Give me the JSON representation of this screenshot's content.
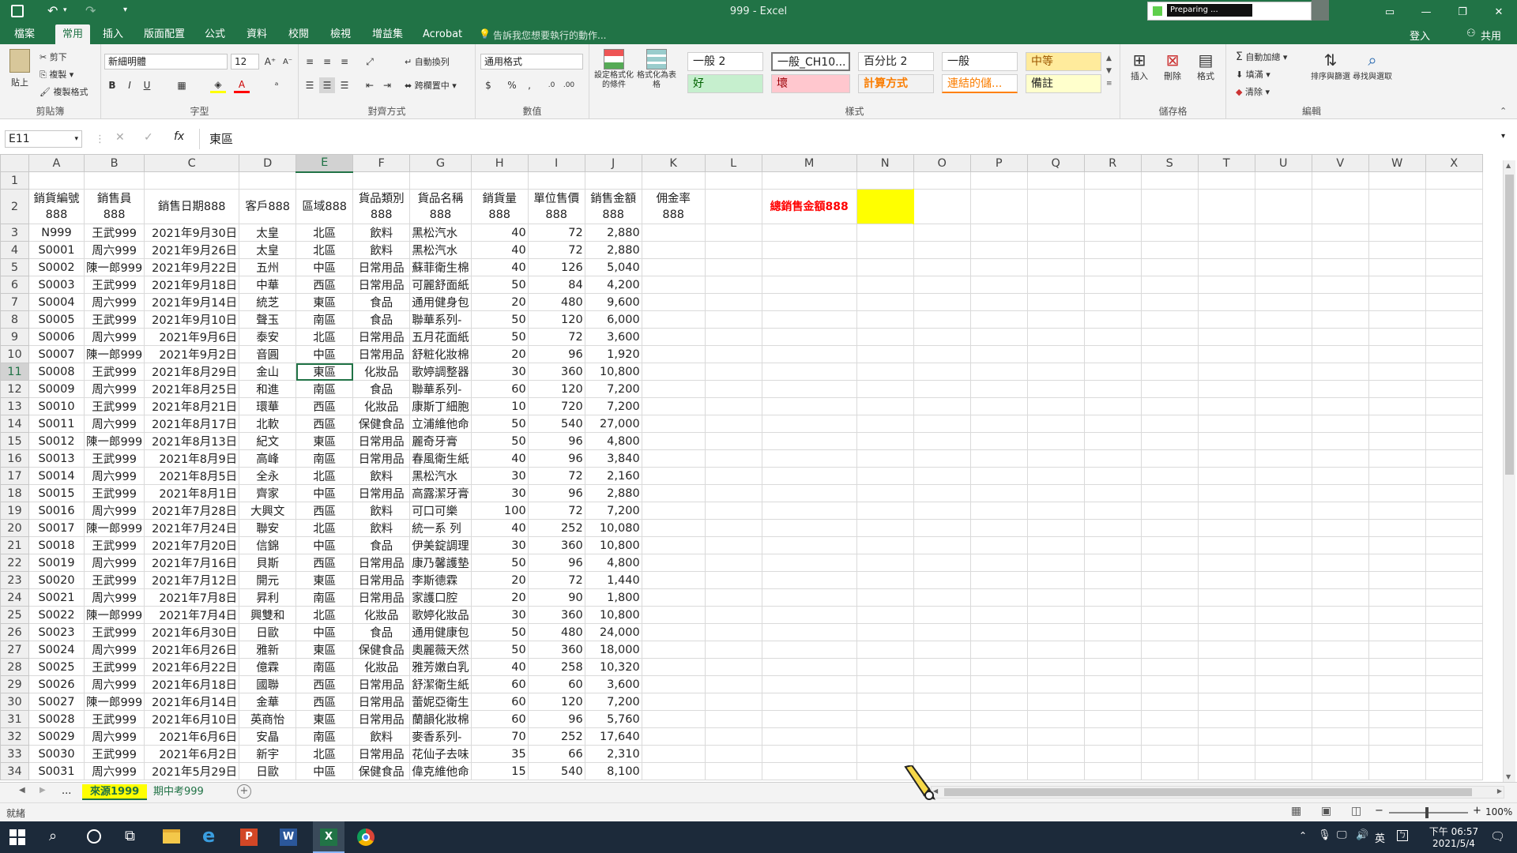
{
  "window": {
    "title": "999 - Excel",
    "preparing": "Preparing ..."
  },
  "qat": {
    "save_icon": "save-icon",
    "undo_icon": "undo-icon",
    "redo_icon": "redo-icon"
  },
  "tabs": [
    "檔案",
    "常用",
    "插入",
    "版面配置",
    "公式",
    "資料",
    "校閱",
    "檢視",
    "增益集",
    "Acrobat"
  ],
  "tellme": "告訴我您想要執行的動作...",
  "account": {
    "signin": "登入",
    "share": "共用"
  },
  "ribbon": {
    "clipboard": {
      "paste": "貼上",
      "cut": "剪下",
      "copy": "複製",
      "format_painter": "複製格式",
      "label": "剪貼簿"
    },
    "font": {
      "name": "新細明體",
      "size": "12",
      "label": "字型"
    },
    "align": {
      "wrap": "自動換列",
      "merge": "跨欄置中",
      "label": "對齊方式"
    },
    "number": {
      "format": "通用格式",
      "label": "數值"
    },
    "styles_btns": {
      "cond": "設定格式化的條件",
      "table": "格式化為表格"
    },
    "styles": {
      "s1": "一般 2",
      "s2": "一般_CH10...",
      "s3": "百分比 2",
      "s4": "一般",
      "s5": "中等",
      "s6": "好",
      "s7": "壞",
      "s8": "計算方式",
      "s9": "連結的儲...",
      "s10": "備註",
      "label": "樣式"
    },
    "cells": {
      "insert": "插入",
      "delete": "刪除",
      "format": "格式",
      "label": "儲存格"
    },
    "editing": {
      "autosum": "自動加總",
      "fill": "填滿",
      "clear": "清除",
      "sort": "排序與篩選",
      "find": "尋找與選取",
      "label": "編輯"
    }
  },
  "formula": {
    "namebox": "E11",
    "fx": "fx",
    "value": "東區"
  },
  "columns": [
    "A",
    "B",
    "C",
    "D",
    "E",
    "F",
    "G",
    "H",
    "I",
    "J",
    "K",
    "L",
    "M",
    "N",
    "O",
    "P",
    "Q",
    "R",
    "S",
    "T",
    "U",
    "V",
    "W",
    "X"
  ],
  "header_row": [
    "銷貨編號 888",
    "銷售員 888",
    "銷售日期888",
    "客戶888",
    "區域888",
    "貨品類別 888",
    "貨品名稱 888",
    "銷貨量 888",
    "單位售價 888",
    "銷售金額 888",
    "佣金率 888"
  ],
  "total_label": "總銷售金額888",
  "rows": [
    [
      "N999",
      "王武999",
      "2021年9月30日",
      "太皇",
      "北區",
      "飲料",
      "黑松汽水",
      "40",
      "72",
      "2,880"
    ],
    [
      "S0001",
      "周六999",
      "2021年9月26日",
      "太皇",
      "北區",
      "飲料",
      "黑松汽水",
      "40",
      "72",
      "2,880"
    ],
    [
      "S0002",
      "陳一郎999",
      "2021年9月22日",
      "五州",
      "中區",
      "日常用品",
      "蘇菲衛生棉",
      "40",
      "126",
      "5,040"
    ],
    [
      "S0003",
      "王武999",
      "2021年9月18日",
      "中華",
      "西區",
      "日常用品",
      "可麗舒面紙",
      "50",
      "84",
      "4,200"
    ],
    [
      "S0004",
      "周六999",
      "2021年9月14日",
      "統芝",
      "東區",
      "食品",
      "通用健身包",
      "20",
      "480",
      "9,600"
    ],
    [
      "S0005",
      "王武999",
      "2021年9月10日",
      "聲玉",
      "南區",
      "食品",
      "聯華系列-",
      "50",
      "120",
      "6,000"
    ],
    [
      "S0006",
      "周六999",
      "2021年9月6日",
      "泰安",
      "北區",
      "日常用品",
      "五月花面紙",
      "50",
      "72",
      "3,600"
    ],
    [
      "S0007",
      "陳一郎999",
      "2021年9月2日",
      "音圓",
      "中區",
      "日常用品",
      "舒粧化妝棉",
      "20",
      "96",
      "1,920"
    ],
    [
      "S0008",
      "王武999",
      "2021年8月29日",
      "金山",
      "東區",
      "化妝品",
      "歌婷調整器",
      "30",
      "360",
      "10,800"
    ],
    [
      "S0009",
      "周六999",
      "2021年8月25日",
      "和進",
      "南區",
      "食品",
      "聯華系列-",
      "60",
      "120",
      "7,200"
    ],
    [
      "S0010",
      "王武999",
      "2021年8月21日",
      "環華",
      "西區",
      "化妝品",
      "康斯丁細胞",
      "10",
      "720",
      "7,200"
    ],
    [
      "S0011",
      "周六999",
      "2021年8月17日",
      "北軟",
      "西區",
      "保健食品",
      "立浦維他命",
      "50",
      "540",
      "27,000"
    ],
    [
      "S0012",
      "陳一郎999",
      "2021年8月13日",
      "紀文",
      "東區",
      "日常用品",
      "麗奇牙膏",
      "50",
      "96",
      "4,800"
    ],
    [
      "S0013",
      "王武999",
      "2021年8月9日",
      "高峰",
      "南區",
      "日常用品",
      "春風衛生紙",
      "40",
      "96",
      "3,840"
    ],
    [
      "S0014",
      "周六999",
      "2021年8月5日",
      "全永",
      "北區",
      "飲料",
      "黑松汽水",
      "30",
      "72",
      "2,160"
    ],
    [
      "S0015",
      "王武999",
      "2021年8月1日",
      "齊家",
      "中區",
      "日常用品",
      "高露潔牙膏",
      "30",
      "96",
      "2,880"
    ],
    [
      "S0016",
      "周六999",
      "2021年7月28日",
      "大興文",
      "西區",
      "飲料",
      "可口可樂",
      "100",
      "72",
      "7,200"
    ],
    [
      "S0017",
      "陳一郎999",
      "2021年7月24日",
      "聯安",
      "北區",
      "飲料",
      "統一系 列",
      "40",
      "252",
      "10,080"
    ],
    [
      "S0018",
      "王武999",
      "2021年7月20日",
      "信錦",
      "中區",
      "食品",
      "伊美錠調理",
      "30",
      "360",
      "10,800"
    ],
    [
      "S0019",
      "周六999",
      "2021年7月16日",
      "貝斯",
      "西區",
      "日常用品",
      "康乃馨護墊",
      "50",
      "96",
      "4,800"
    ],
    [
      "S0020",
      "王武999",
      "2021年7月12日",
      "開元",
      "東區",
      "日常用品",
      "李斯德霖",
      "20",
      "72",
      "1,440"
    ],
    [
      "S0021",
      "周六999",
      "2021年7月8日",
      "昇利",
      "南區",
      "日常用品",
      "家護口腔",
      "20",
      "90",
      "1,800"
    ],
    [
      "S0022",
      "陳一郎999",
      "2021年7月4日",
      "興雙和",
      "北區",
      "化妝品",
      "歌婷化妝品",
      "30",
      "360",
      "10,800"
    ],
    [
      "S0023",
      "王武999",
      "2021年6月30日",
      "日歐",
      "中區",
      "食品",
      "通用健康包",
      "50",
      "480",
      "24,000"
    ],
    [
      "S0024",
      "周六999",
      "2021年6月26日",
      "雅新",
      "東區",
      "保健食品",
      "奧麗薇天然",
      "50",
      "360",
      "18,000"
    ],
    [
      "S0025",
      "王武999",
      "2021年6月22日",
      "億霖",
      "南區",
      "化妝品",
      "雅芳嫩白乳",
      "40",
      "258",
      "10,320"
    ],
    [
      "S0026",
      "周六999",
      "2021年6月18日",
      "國聯",
      "西區",
      "日常用品",
      "舒潔衛生紙",
      "60",
      "60",
      "3,600"
    ],
    [
      "S0027",
      "陳一郎999",
      "2021年6月14日",
      "金華",
      "西區",
      "日常用品",
      "蕾妮亞衛生",
      "60",
      "120",
      "7,200"
    ],
    [
      "S0028",
      "王武999",
      "2021年6月10日",
      "英商怡",
      "東區",
      "日常用品",
      "蘭韻化妝棉",
      "60",
      "96",
      "5,760"
    ],
    [
      "S0029",
      "周六999",
      "2021年6月6日",
      "安晶",
      "南區",
      "飲料",
      "麥香系列-",
      "70",
      "252",
      "17,640"
    ],
    [
      "S0030",
      "王武999",
      "2021年6月2日",
      "新宇",
      "北區",
      "日常用品",
      "花仙子去味",
      "35",
      "66",
      "2,310"
    ],
    [
      "S0031",
      "周六999",
      "2021年5月29日",
      "日歐",
      "中區",
      "保健食品",
      "偉克維他命",
      "15",
      "540",
      "8,100"
    ]
  ],
  "sheets": {
    "more": "...",
    "tab1": "來源1999",
    "tab2": "期中考999"
  },
  "status": {
    "ready": "就緒",
    "zoom": "100%"
  },
  "taskbar": {
    "time": "下午 06:57",
    "date": "2021/5/4",
    "ime": "英"
  },
  "colors": {
    "excel_green": "#217346",
    "highlight_yellow": "#ffff00",
    "red_text": "#ff0000",
    "sheet_tab_yellow": "#ffff00"
  }
}
